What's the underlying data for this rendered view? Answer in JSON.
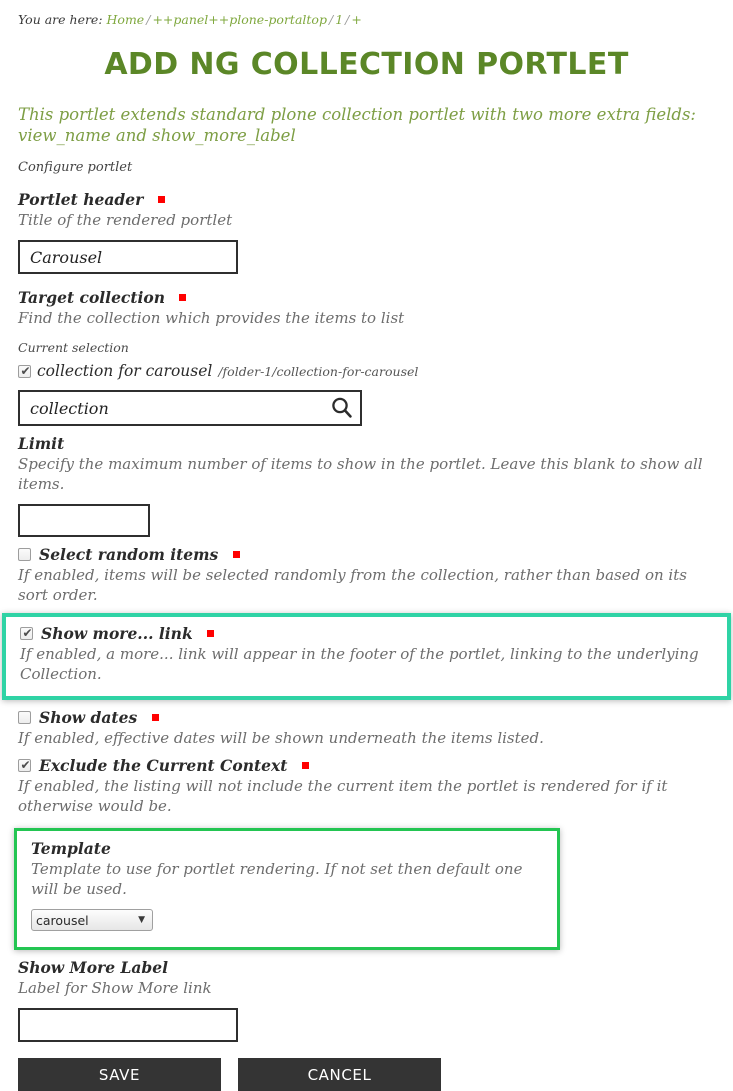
{
  "breadcrumb": {
    "label": "You are here:",
    "items": [
      {
        "text": "Home",
        "link": true
      },
      {
        "text": "++panel++plone-portaltop",
        "link": true
      },
      {
        "text": "1",
        "link": true
      },
      {
        "text": "+",
        "link": false
      }
    ],
    "separator": "/"
  },
  "page": {
    "title": "Add NG Collection Portlet",
    "description": "This portlet extends standard plone collection portlet with two more extra fields: view_name and show_more_label",
    "legend": "Configure portlet"
  },
  "colors": {
    "title_green": "#5b8727",
    "description_green": "#7d9e44",
    "link_green": "#7fa83e",
    "required_red": "#ff0000",
    "highlight_teal": "#2fd3a5",
    "highlight_green": "#23c552",
    "button_dark": "#343434"
  },
  "fields": {
    "portlet_header": {
      "label": "Portlet header",
      "required": true,
      "help": "Title of the rendered portlet",
      "value": "Carousel",
      "placeholder": ""
    },
    "target_collection": {
      "label": "Target collection",
      "required": true,
      "help": "Find the collection which provides the items to list",
      "current_selection_label": "Current selection",
      "selection": {
        "checked": true,
        "title": "collection for carousel",
        "path": "/folder-1/collection-for-carousel"
      },
      "search_value": "collection",
      "search_placeholder": "",
      "search_icon": "search-icon"
    },
    "limit": {
      "label": "Limit",
      "required": false,
      "help": "Specify the maximum number of items to show in the portlet. Leave this blank to show all items.",
      "value": "",
      "placeholder": ""
    },
    "select_random": {
      "label": "Select random items",
      "required": true,
      "checked": false,
      "help": "If enabled, items will be selected randomly from the collection, rather than based on its sort order."
    },
    "show_more_link": {
      "label": "Show more... link",
      "required": true,
      "checked": true,
      "help": "If enabled, a more... link will appear in the footer of the portlet, linking to the underlying Collection.",
      "highlighted": true
    },
    "show_dates": {
      "label": "Show dates",
      "required": true,
      "checked": false,
      "help": "If enabled, effective dates will be shown underneath the items listed."
    },
    "exclude_context": {
      "label": "Exclude the Current Context",
      "required": true,
      "checked": true,
      "help": "If enabled, the listing will not include the current item the portlet is rendered for if it otherwise would be."
    },
    "template": {
      "label": "Template",
      "required": false,
      "help": "Template to use for portlet rendering. If not set then default one will be used.",
      "selected": "carousel",
      "options": [
        "carousel"
      ],
      "highlighted": true
    },
    "show_more_label": {
      "label": "Show More Label",
      "required": false,
      "help": "Label for Show More link",
      "value": "",
      "placeholder": ""
    }
  },
  "actions": {
    "save_label": "Save",
    "cancel_label": "Cancel"
  }
}
